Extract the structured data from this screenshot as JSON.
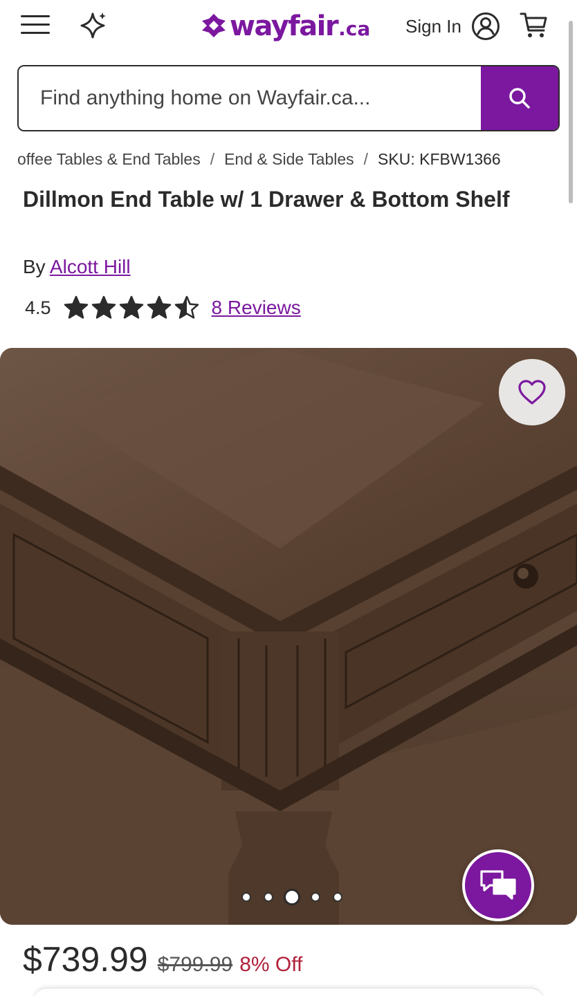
{
  "header": {
    "logo_text": "wayfair",
    "logo_suffix": ".ca",
    "sign_in_label": "Sign In",
    "icons": [
      "hamburger-menu-icon",
      "sparkle-icon",
      "account-icon",
      "cart-icon"
    ]
  },
  "search": {
    "placeholder": "Find anything home on Wayfair.ca..."
  },
  "breadcrumb": {
    "items": [
      "offee Tables & End Tables",
      "End & Side Tables"
    ],
    "separator": "/",
    "sku": "SKU: KFBW1366"
  },
  "product": {
    "title": "Dillmon End Table w/ 1 Drawer & Bottom Shelf",
    "by_prefix": "By",
    "brand": "Alcott Hill",
    "rating_value": "4.5",
    "rating": 4.5,
    "rating_max": 5,
    "reviews_label": "8 Reviews"
  },
  "gallery": {
    "image_count": 5,
    "active_index": 2
  },
  "pricing": {
    "current": "$739.99",
    "original": "$799.99",
    "discount": "8% Off"
  },
  "colors": {
    "brand_purple": "#7b189f",
    "discount_red": "#b0213b",
    "text": "#2b2b2b"
  }
}
